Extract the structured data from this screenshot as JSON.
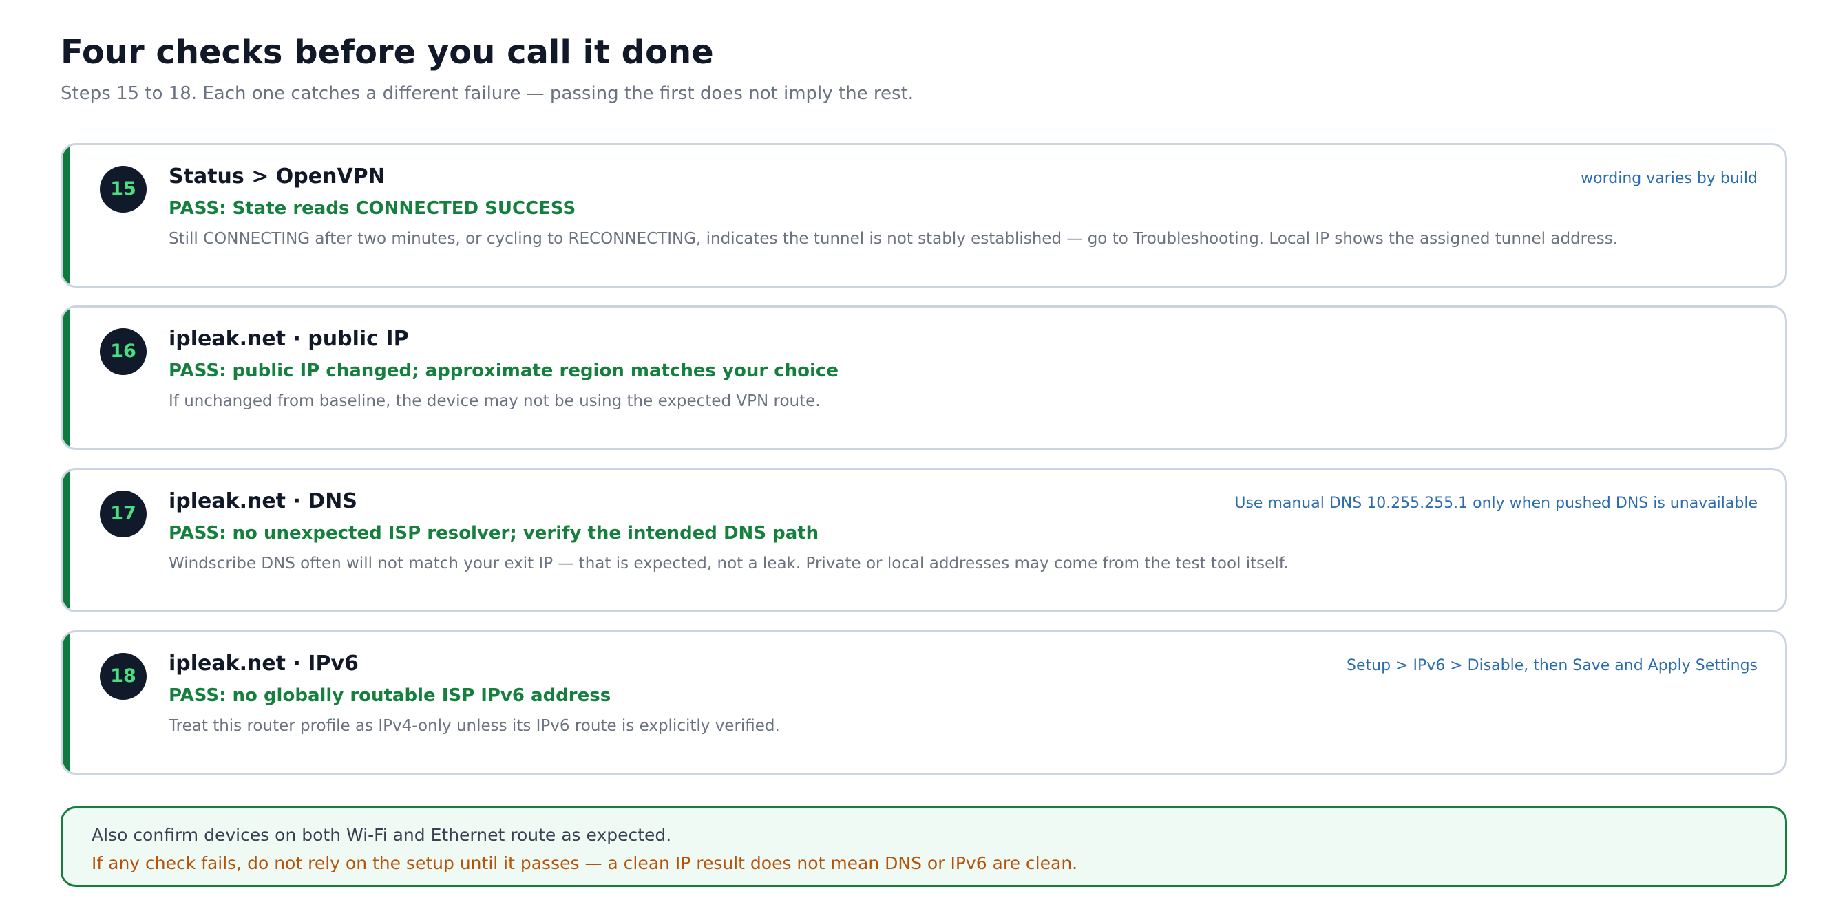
{
  "header": {
    "title": "Four checks before you call it done",
    "subtitle": "Steps 15 to 18. Each one catches a different failure — passing the first does not imply the rest."
  },
  "checks": [
    {
      "step": "15",
      "heading": "Status > OpenVPN",
      "note": "wording varies by build",
      "pass": "PASS: State reads CONNECTED SUCCESS",
      "detail": "Still CONNECTING after two minutes, or cycling to RECONNECTING, indicates the tunnel is not stably established — go to Troubleshooting. Local IP shows the assigned tunnel address."
    },
    {
      "step": "16",
      "heading": "ipleak.net · public IP",
      "note": "",
      "pass": "PASS: public IP changed; approximate region matches your choice",
      "detail": "If unchanged from baseline, the device may not be using the expected VPN route."
    },
    {
      "step": "17",
      "heading": "ipleak.net · DNS",
      "note": "Use manual DNS 10.255.255.1 only when pushed DNS is unavailable",
      "pass": "PASS: no unexpected ISP resolver; verify the intended DNS path",
      "detail": "Windscribe DNS often will not match your exit IP — that is expected, not a leak. Private or local addresses may come from the test tool itself."
    },
    {
      "step": "18",
      "heading": "ipleak.net · IPv6",
      "note": "Setup > IPv6 > Disable, then Save and Apply Settings",
      "pass": "PASS: no globally routable ISP IPv6 address",
      "detail": "Treat this router profile as IPv4-only unless its IPv6 route is explicitly verified."
    }
  ],
  "footer": {
    "line1": "Also confirm devices on both Wi-Fi and Ethernet route as expected.",
    "line2": "If any check fails, do not rely on the setup until it passes — a clean IP result does not mean DNS or IPv6 are clean."
  },
  "colors": {
    "accent_green": "#0f7a3d",
    "pass_green": "#15803d",
    "note_blue": "#2b6cb0",
    "warning_amber": "#b45309",
    "badge_dark": "#111a2b"
  }
}
